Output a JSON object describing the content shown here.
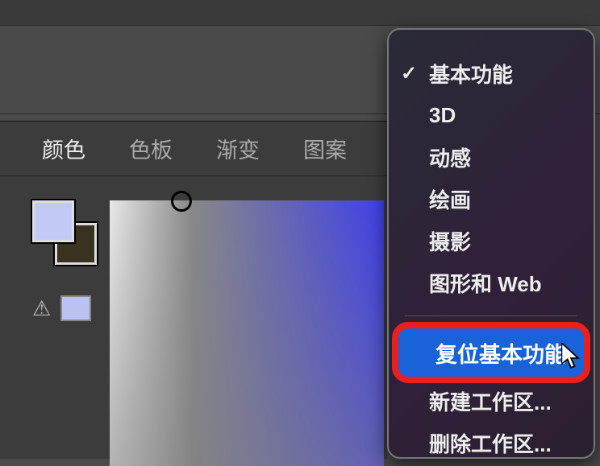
{
  "panel": {
    "tabs": {
      "color": "颜色",
      "swatches": "色板",
      "gradient": "渐变",
      "pattern": "图案"
    },
    "fg_color": "#c3c9f5",
    "bg_color": "#3a3220"
  },
  "menu": {
    "items": {
      "essentials": "基本功能",
      "threeD": "3D",
      "motion": "动感",
      "painting": "绘画",
      "photography": "摄影",
      "graphic_web": "图形和 Web"
    },
    "reset": "复位基本功能",
    "new_workspace": "新建工作区...",
    "delete_workspace": "删除工作区..."
  }
}
